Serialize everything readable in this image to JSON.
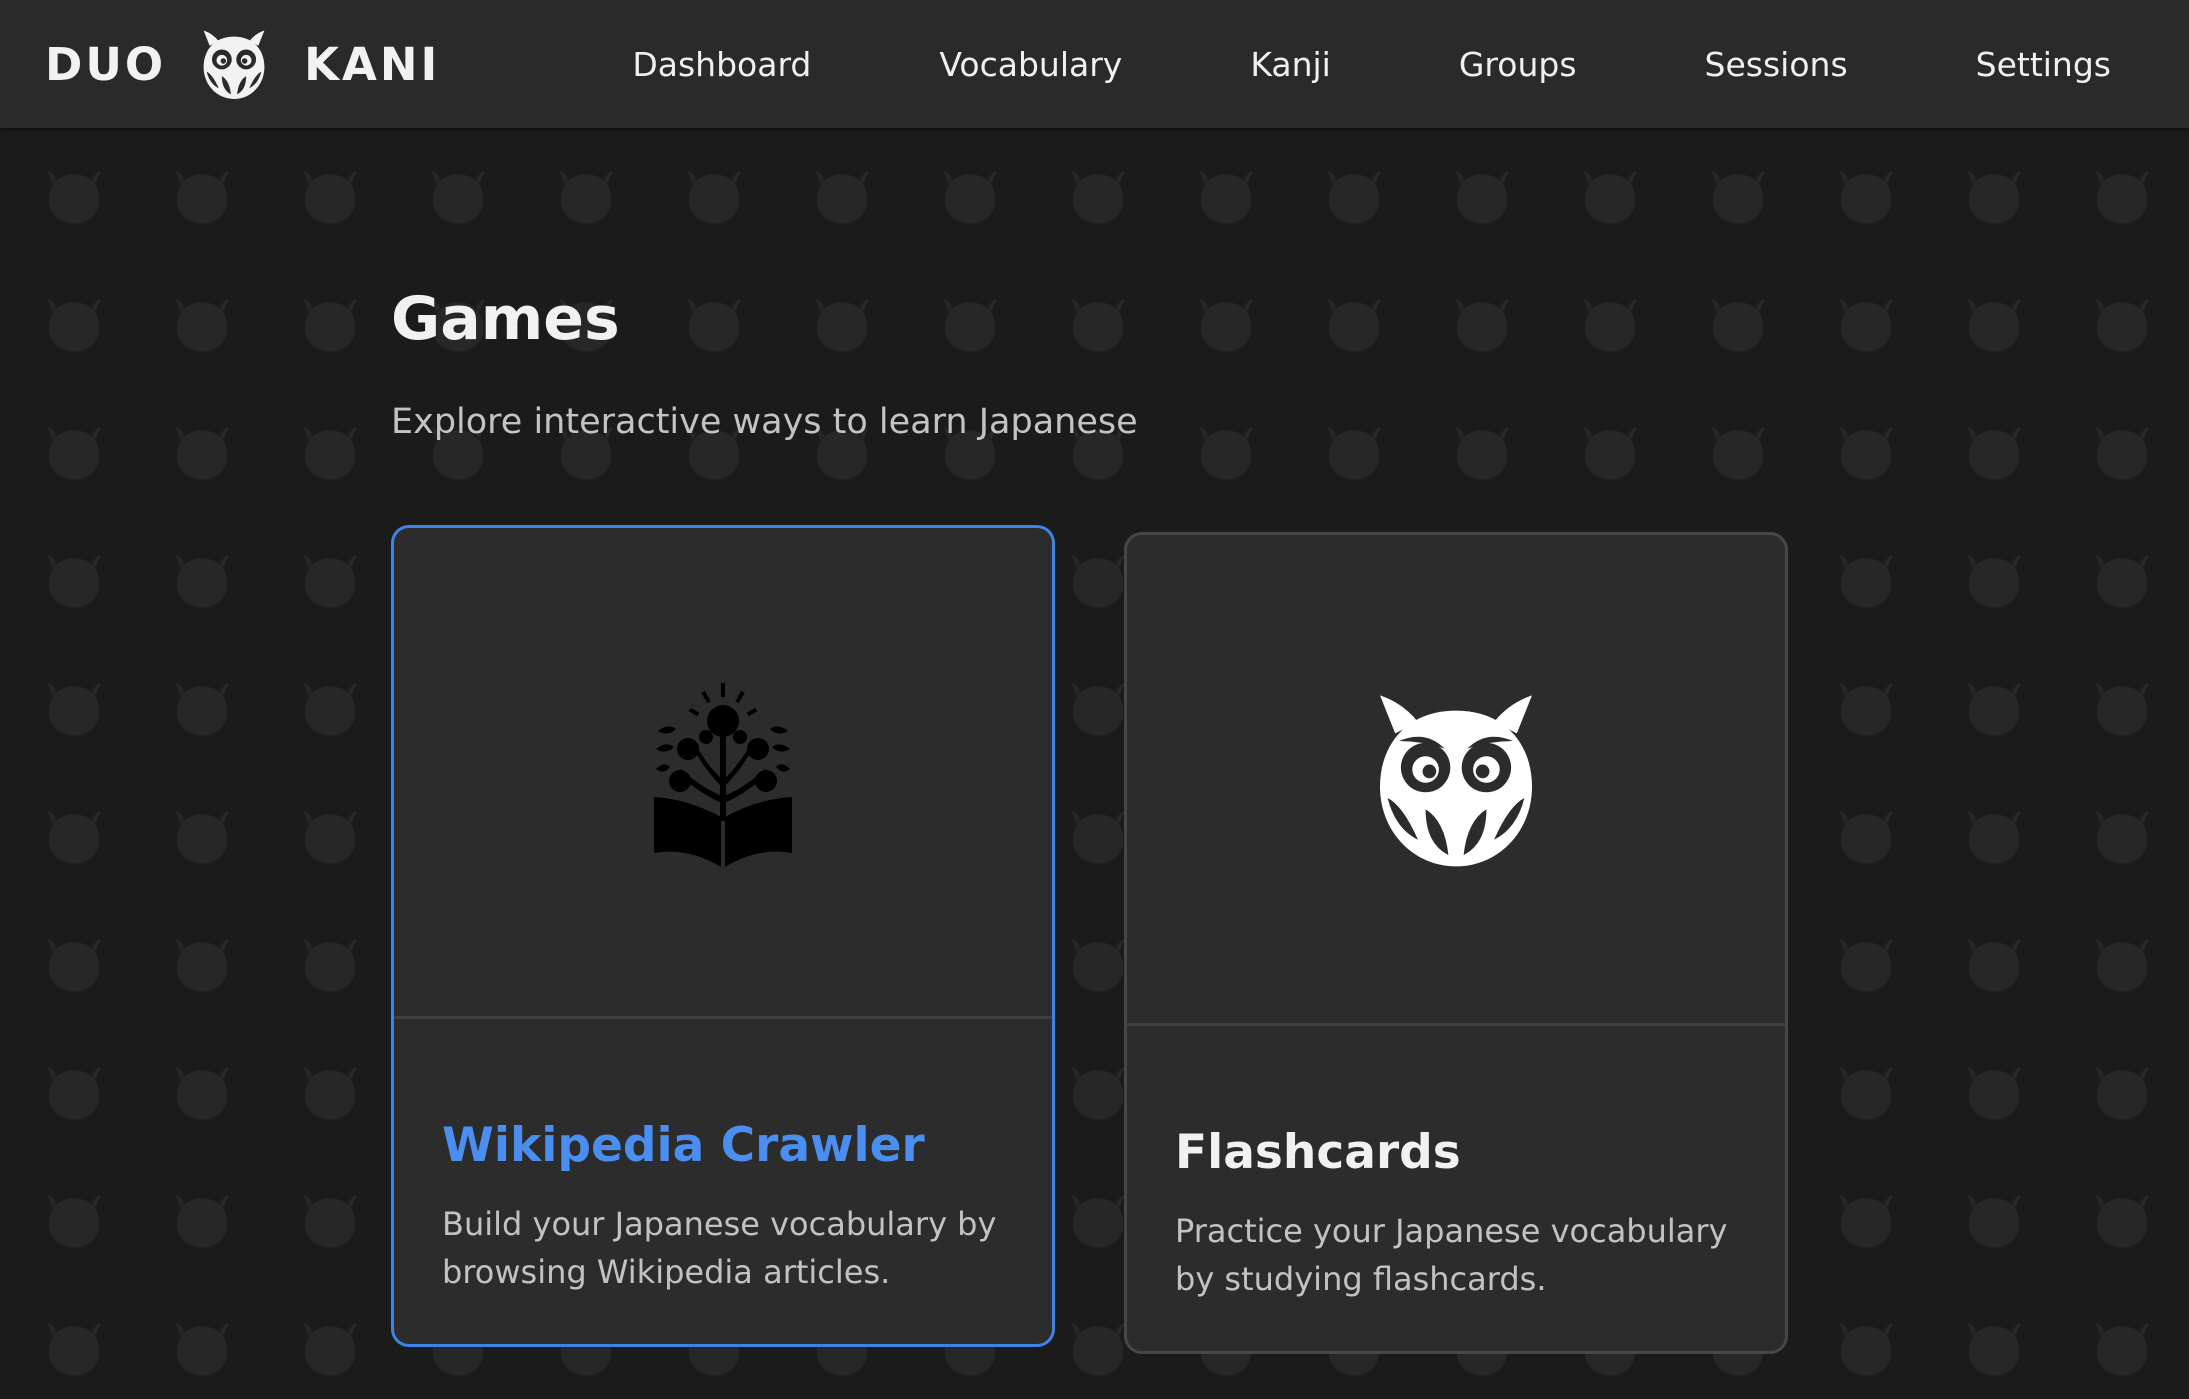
{
  "header": {
    "brand_left": "DUO",
    "brand_right": "KANI",
    "logo_icon": "owl-logo-icon",
    "nav": [
      {
        "label": "Dashboard"
      },
      {
        "label": "Vocabulary"
      },
      {
        "label": "Kanji"
      },
      {
        "label": "Groups"
      },
      {
        "label": "Sessions"
      },
      {
        "label": "Settings"
      }
    ]
  },
  "main": {
    "title": "Games",
    "subtitle": "Explore interactive ways to learn Japanese",
    "cards": [
      {
        "title": "Wikipedia Crawler",
        "description": "Build your Japanese vocabulary by browsing Wikipedia articles.",
        "icon": "book-tree-icon",
        "state": "selected"
      },
      {
        "title": "Flashcards",
        "description": "Practice your Japanese vocabulary by studying flashcards.",
        "icon": "owl-icon",
        "state": "default"
      }
    ]
  },
  "colors": {
    "background": "#1b1b1b",
    "header_bg": "#2a2a2a",
    "card_bg": "#2c2c2c",
    "accent": "#3e84e6",
    "text": "#f1f1f1",
    "muted_text": "#c2c2c2"
  }
}
